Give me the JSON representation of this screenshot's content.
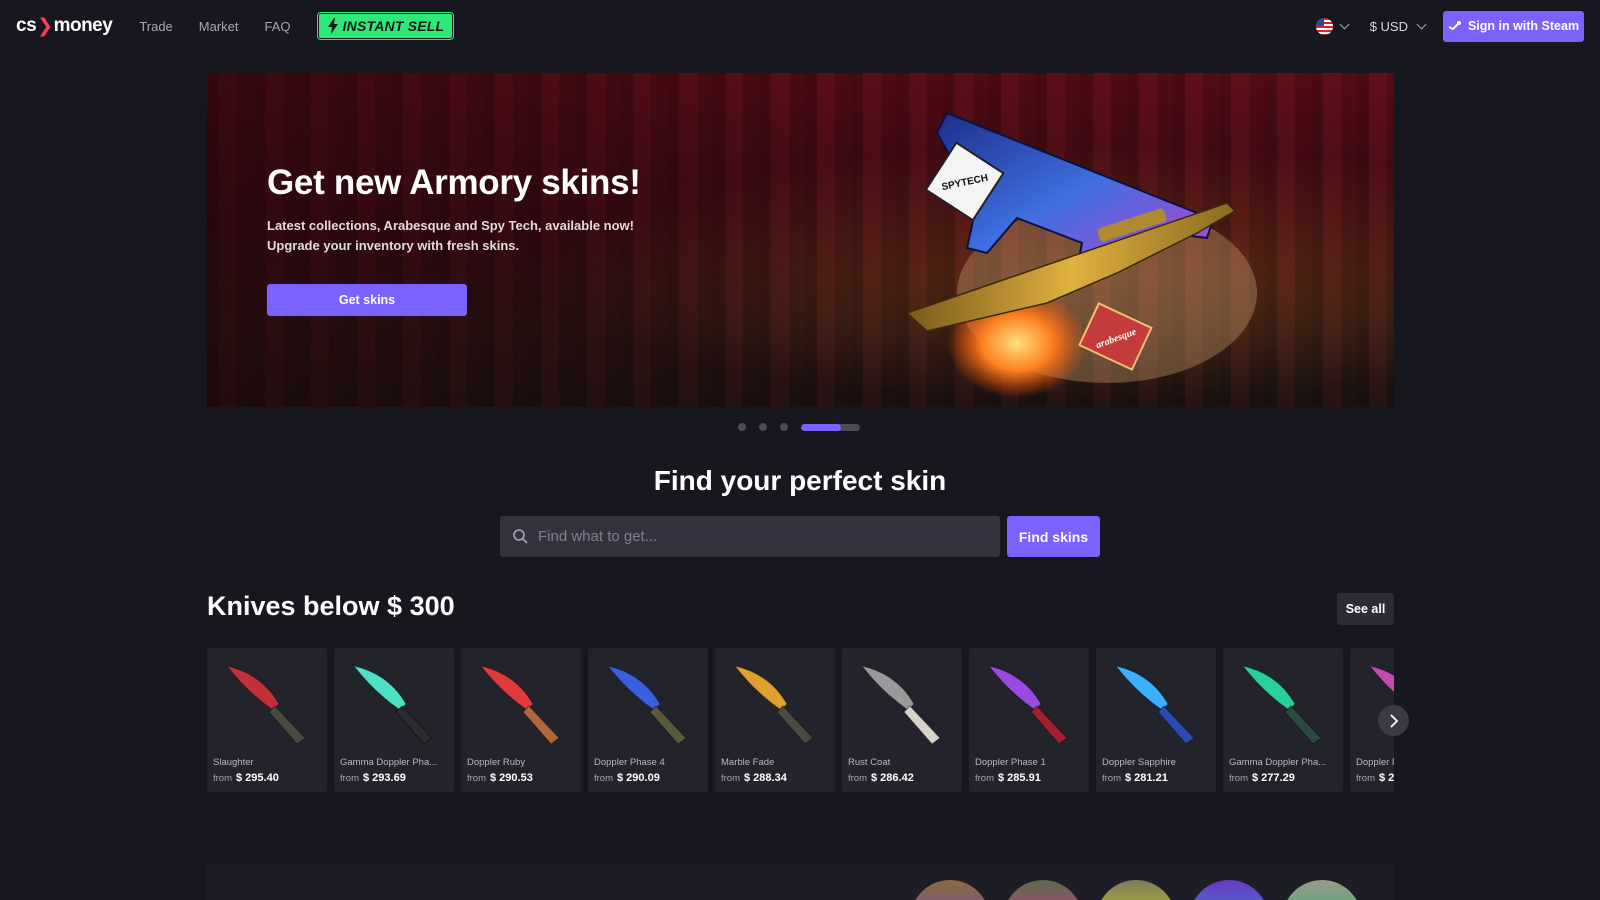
{
  "header": {
    "logo_text_left": "cs",
    "logo_mark": "❯",
    "logo_text_right": "money",
    "nav": [
      "Trade",
      "Market",
      "FAQ"
    ],
    "instant_sell_label": "INSTANT SELL",
    "currency": "$ USD",
    "sign_in_label": "Sign in with Steam"
  },
  "banner": {
    "title": "Get new Armory skins!",
    "subtitle_line1": "Latest collections, Arabesque and Spy Tech, available now!",
    "subtitle_line2": "Upgrade your inventory with fresh skins.",
    "cta_label": "Get skins",
    "badge_spytech": "SPYTECH",
    "badge_arabesque": "arabesque"
  },
  "carousel": {
    "slide_count": 4,
    "active_index": 3,
    "active_progress": 0.68
  },
  "search": {
    "title": "Find your perfect skin",
    "placeholder": "Find what to get...",
    "button_label": "Find skins"
  },
  "knives": {
    "title": "Knives below $ 300",
    "see_all_label": "See all",
    "from_label": "from",
    "items": [
      {
        "name": "Slaughter",
        "price": "$ 295.40",
        "blade": "#c2303a",
        "handle": "#4a4a44"
      },
      {
        "name": "Gamma Doppler Pha...",
        "price": "$ 293.69",
        "blade": "#4fe0c8",
        "handle": "#2b2b30"
      },
      {
        "name": "Doppler Ruby",
        "price": "$ 290.53",
        "blade": "#e03a3a",
        "handle": "#b0683a"
      },
      {
        "name": "Doppler Phase 4",
        "price": "$ 290.09",
        "blade": "#3a5ee0",
        "handle": "#5a5a3a"
      },
      {
        "name": "Marble Fade",
        "price": "$ 288.34",
        "blade": "#e0a030",
        "handle": "#4a4a44"
      },
      {
        "name": "Rust Coat",
        "price": "$ 286.42",
        "blade": "#9a9a9a",
        "handle": "#d8d4cc"
      },
      {
        "name": "Doppler Phase 1",
        "price": "$ 285.91",
        "blade": "#9a4ae0",
        "handle": "#a02030"
      },
      {
        "name": "Doppler Sapphire",
        "price": "$ 281.21",
        "blade": "#3ab0ff",
        "handle": "#2a4ab0"
      },
      {
        "name": "Gamma Doppler Pha...",
        "price": "$ 277.29",
        "blade": "#2ad09a",
        "handle": "#2b4a40"
      },
      {
        "name": "Doppler P",
        "price": "$ 2",
        "blade": "#c24ab0",
        "handle": "#3a3a44"
      }
    ]
  },
  "colors": {
    "accent": "#7b61ff",
    "instant_sell": "#2ee97a",
    "background": "#17171f",
    "card": "#23232c"
  },
  "icons": {
    "search": "search-icon",
    "bolt": "bolt-icon",
    "steam": "steam-icon",
    "chevron": "chevron-down-icon",
    "next": "chevron-right-icon",
    "flag": "us-flag-icon"
  }
}
